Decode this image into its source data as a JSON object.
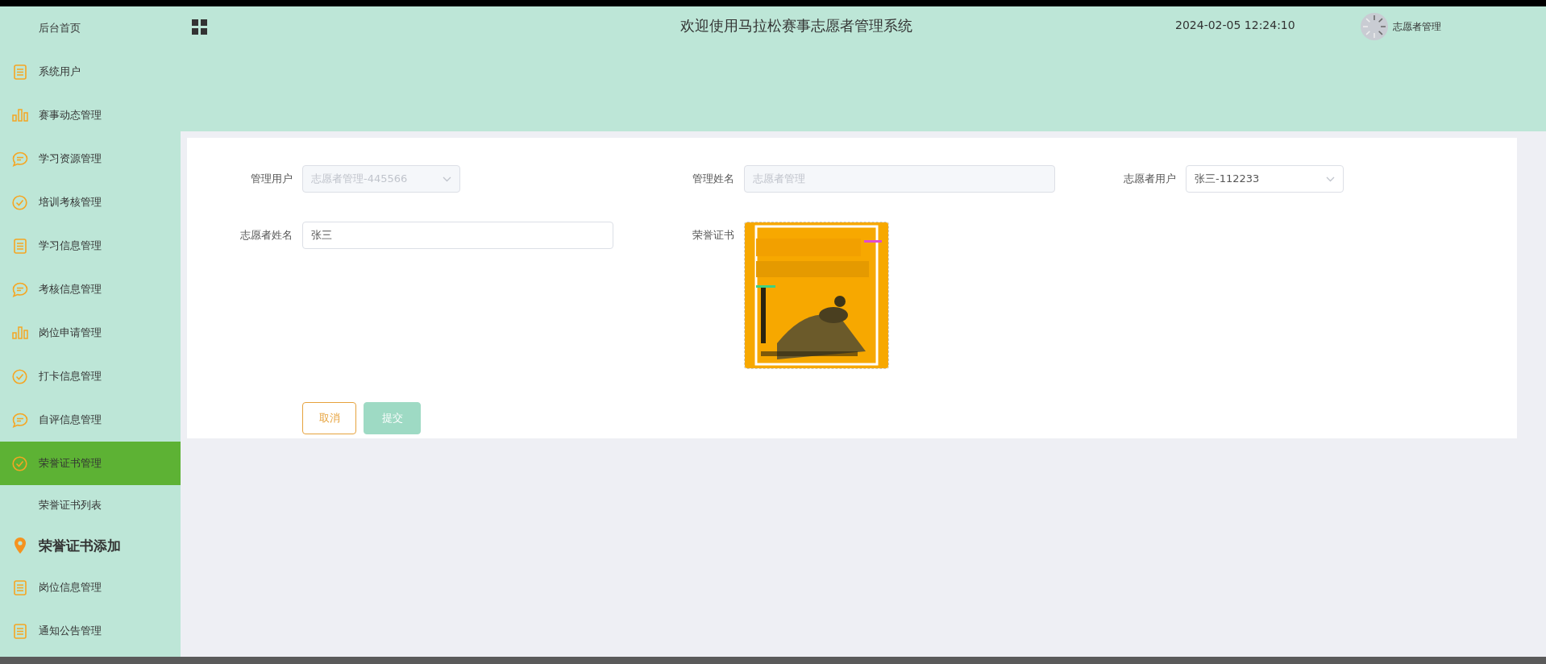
{
  "sidebar": {
    "items": [
      {
        "label": "后台首页",
        "kind": "plain",
        "selected": false
      },
      {
        "label": "系统用户",
        "kind": "doc",
        "selected": false
      },
      {
        "label": "赛事动态管理",
        "kind": "bars",
        "selected": false
      },
      {
        "label": "学习资源管理",
        "kind": "chat",
        "selected": false
      },
      {
        "label": "培训考核管理",
        "kind": "check",
        "selected": false
      },
      {
        "label": "学习信息管理",
        "kind": "doc",
        "selected": false
      },
      {
        "label": "考核信息管理",
        "kind": "chat",
        "selected": false
      },
      {
        "label": "岗位申请管理",
        "kind": "bars",
        "selected": false
      },
      {
        "label": "打卡信息管理",
        "kind": "check",
        "selected": false
      },
      {
        "label": "自评信息管理",
        "kind": "chat",
        "selected": false
      },
      {
        "label": "荣誉证书管理",
        "kind": "check",
        "selected": true
      },
      {
        "label": "荣誉证书列表",
        "kind": "subitem",
        "selected": false
      },
      {
        "label": "荣誉证书添加",
        "kind": "current",
        "selected": false
      },
      {
        "label": "岗位信息管理",
        "kind": "doc",
        "selected": false
      },
      {
        "label": "通知公告管理",
        "kind": "doc",
        "selected": false
      }
    ]
  },
  "header": {
    "title": "欢迎使用马拉松赛事志愿者管理系统",
    "datetime": "2024-02-05 12:24:10",
    "user": "志愿者管理"
  },
  "form": {
    "rows": [
      [
        {
          "label": "管理用户",
          "kind": "select",
          "value": "志愿者管理-445566",
          "disabled": true
        },
        {
          "label": "管理姓名",
          "kind": "input",
          "value": "志愿者管理",
          "disabled": true
        },
        {
          "label": "志愿者用户",
          "kind": "select",
          "value": "张三-112233",
          "disabled": false
        }
      ],
      [
        {
          "label": "志愿者姓名",
          "kind": "input",
          "value": "张三",
          "disabled": false
        },
        {
          "label": "荣誉证书",
          "kind": "picture"
        }
      ]
    ],
    "buttons": [
      {
        "label": "取消",
        "kind": "cancel"
      },
      {
        "label": "提交",
        "kind": "submit"
      }
    ]
  }
}
